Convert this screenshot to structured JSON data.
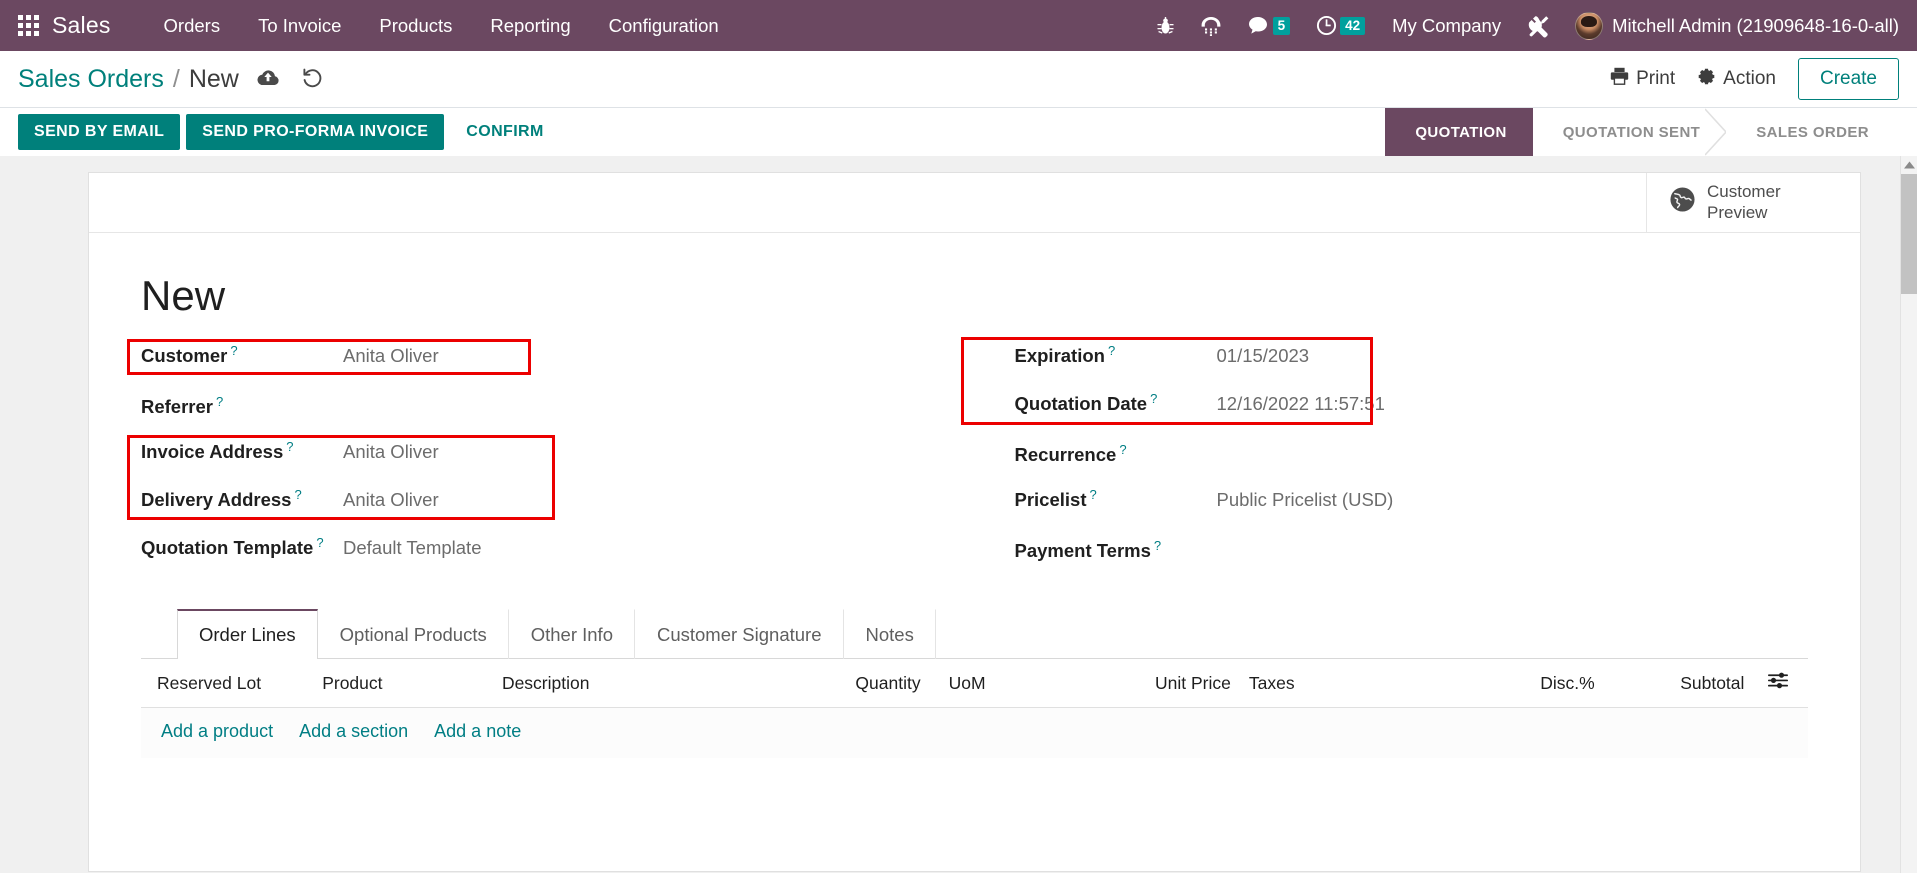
{
  "navbar": {
    "apps_icon": "apps-grid-icon",
    "brand": "Sales",
    "menus": [
      "Orders",
      "To Invoice",
      "Products",
      "Reporting",
      "Configuration"
    ],
    "icons": [
      {
        "name": "bug-icon",
        "label": "debug"
      },
      {
        "name": "phone-icon",
        "label": "voip"
      },
      {
        "name": "messages-icon",
        "label": "messages",
        "badge": "5"
      },
      {
        "name": "activity-clock-icon",
        "label": "activities",
        "badge": "42"
      }
    ],
    "messages_badge": "5",
    "activities_badge": "42",
    "company": "My Company",
    "settings_icon": "tools-icon",
    "user": "Mitchell Admin (21909648-16-0-all)"
  },
  "control_panel": {
    "breadcrumb_parent": "Sales Orders",
    "breadcrumb_separator": "/",
    "breadcrumb_current": "New",
    "save_icon": "cloud-upload-icon",
    "discard_icon": "undo-icon",
    "print_label": "Print",
    "print_icon": "printer-icon",
    "action_label": "Action",
    "action_icon": "gear-icon",
    "create_label": "Create"
  },
  "action_bar": {
    "buttons": [
      {
        "label": "SEND BY EMAIL",
        "style": "primary"
      },
      {
        "label": "SEND PRO-FORMA INVOICE",
        "style": "primary"
      },
      {
        "label": "CONFIRM",
        "style": "link"
      }
    ],
    "stages": [
      {
        "label": "QUOTATION",
        "active": true
      },
      {
        "label": "QUOTATION SENT",
        "active": false
      },
      {
        "label": "SALES ORDER",
        "active": false
      }
    ]
  },
  "stat_buttons": [
    {
      "icon": "globe-icon",
      "line1": "Customer",
      "line2": "Preview"
    }
  ],
  "form": {
    "title": "New",
    "left_fields": [
      {
        "label": "Customer",
        "tooltip": "?",
        "value": "Anita Oliver"
      },
      {
        "label": "Referrer",
        "tooltip": "?",
        "value": ""
      },
      {
        "label": "Invoice Address",
        "tooltip": "?",
        "value": "Anita Oliver"
      },
      {
        "label": "Delivery Address",
        "tooltip": "?",
        "value": "Anita Oliver"
      },
      {
        "label": "Quotation Template",
        "tooltip": "?",
        "value": "Default Template"
      }
    ],
    "right_fields": [
      {
        "label": "Expiration",
        "tooltip": "?",
        "value": "01/15/2023"
      },
      {
        "label": "Quotation Date",
        "tooltip": "?",
        "value": "12/16/2022 11:57:51"
      },
      {
        "label": "Recurrence",
        "tooltip": "?",
        "value": ""
      },
      {
        "label": "Pricelist",
        "tooltip": "?",
        "value": "Public Pricelist (USD)"
      },
      {
        "label": "Payment Terms",
        "tooltip": "?",
        "value": ""
      }
    ]
  },
  "notebook": {
    "tabs": [
      {
        "label": "Order Lines",
        "active": true
      },
      {
        "label": "Optional Products",
        "active": false
      },
      {
        "label": "Other Info",
        "active": false
      },
      {
        "label": "Customer Signature",
        "active": false
      },
      {
        "label": "Notes",
        "active": false
      }
    ],
    "columns": [
      "Reserved Lot",
      "Product",
      "Description",
      "Quantity",
      "UoM",
      "Unit Price",
      "Taxes",
      "Disc.%",
      "Subtotal"
    ],
    "optional_columns_icon": "sliders-icon",
    "add_links": [
      "Add a product",
      "Add a section",
      "Add a note"
    ]
  },
  "annotations": {
    "color": "#ec0000",
    "boxes": [
      {
        "name": "customer-field-highlight"
      },
      {
        "name": "addresses-highlight"
      },
      {
        "name": "dates-highlight"
      }
    ]
  },
  "scrollbar": {
    "up_icon": "caret-up-icon",
    "down_icon": "caret-down-icon"
  }
}
